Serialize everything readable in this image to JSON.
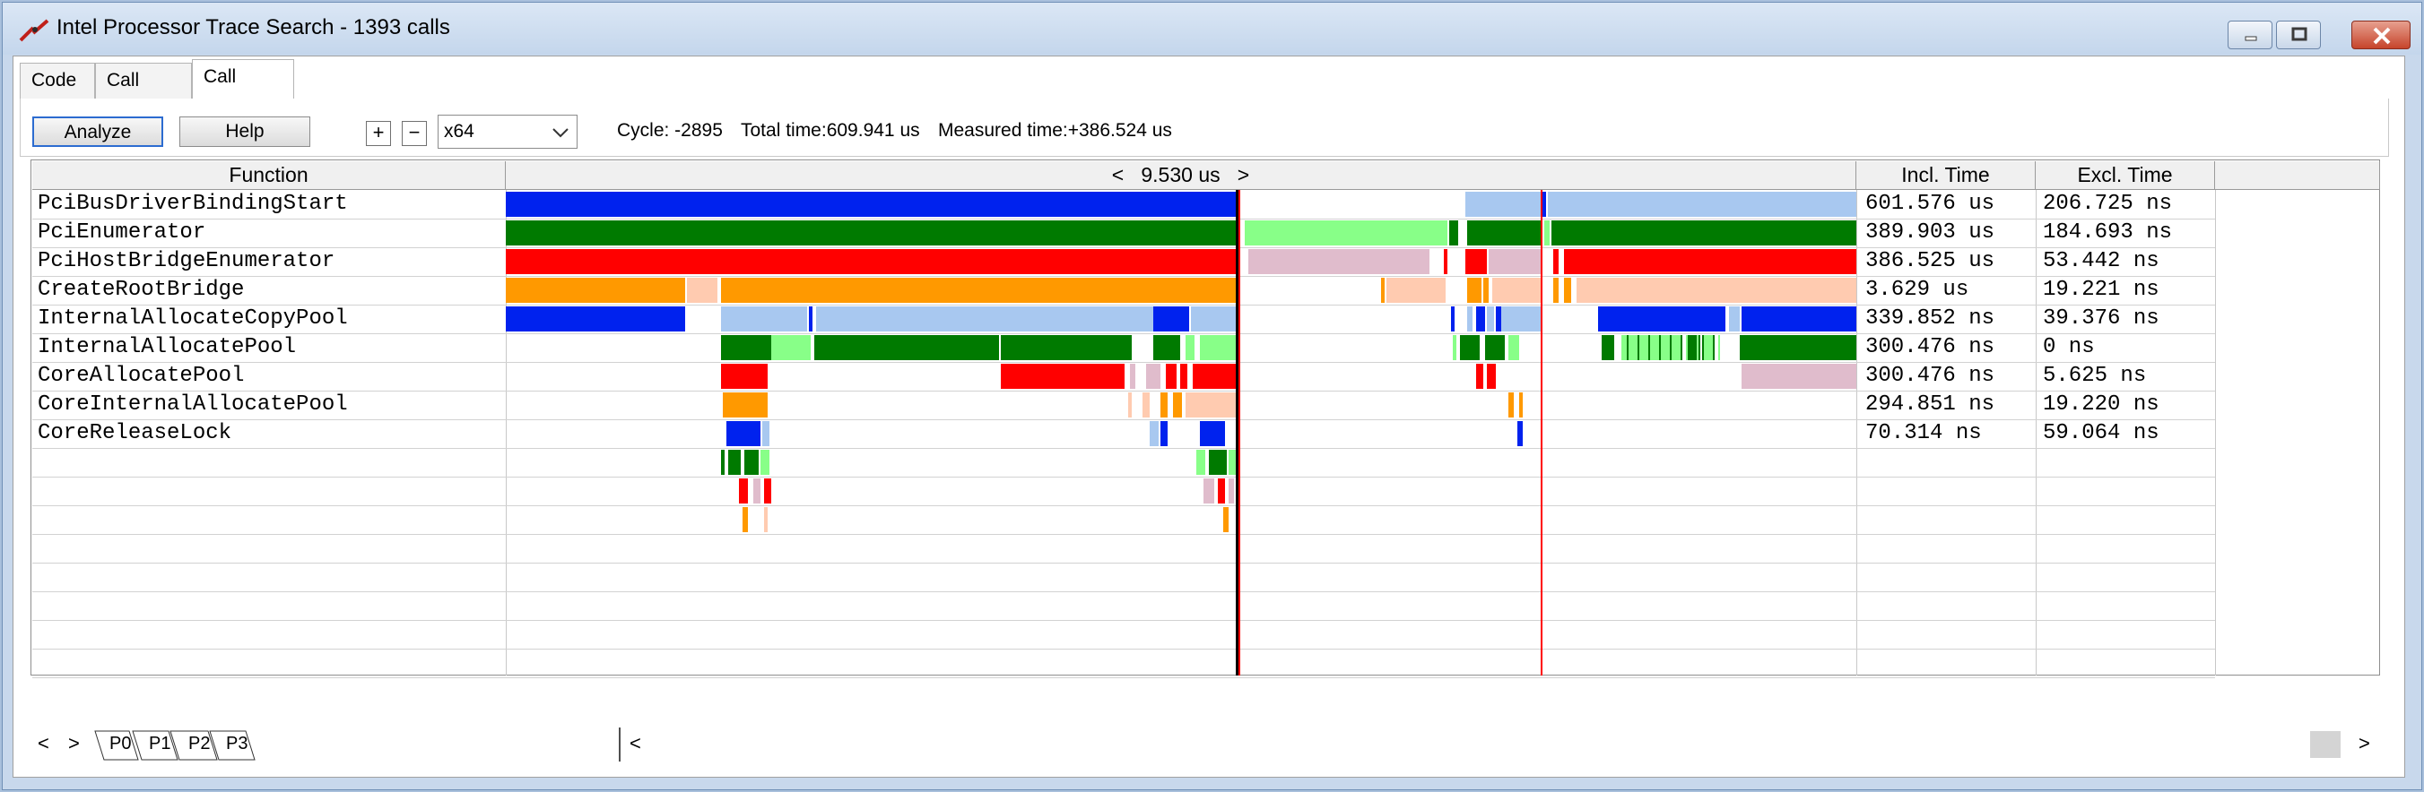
{
  "window": {
    "title": "Intel Processor Trace Search - 1393 calls"
  },
  "tabs": [
    {
      "label": "Code",
      "active": false
    },
    {
      "label": "Call Tree",
      "active": false
    },
    {
      "label": "Call Chart",
      "active": true
    }
  ],
  "toolbar": {
    "analyze_label": "Analyze",
    "help_label": "Help",
    "zoom_in": "+",
    "zoom_out": "−",
    "arch_value": "x64",
    "cycle": "Cycle: -2895",
    "total_time": "Total time:609.941 us",
    "measured_time": "Measured time:+386.524 us"
  },
  "columns": {
    "function": "Function",
    "timeline": "<   9.530 us   >",
    "incl": "Incl. Time",
    "excl": "Excl. Time"
  },
  "rows": [
    {
      "function": "PciBusDriverBindingStart",
      "incl": "601.576 us",
      "excl": "206.725 ns"
    },
    {
      "function": "PciEnumerator",
      "incl": "389.903 us",
      "excl": "184.693 ns"
    },
    {
      "function": "PciHostBridgeEnumerator",
      "incl": "386.525 us",
      "excl": "53.442 ns"
    },
    {
      "function": "CreateRootBridge",
      "incl": "3.629 us",
      "excl": "19.221 ns"
    },
    {
      "function": "InternalAllocateCopyPool",
      "incl": "339.852 ns",
      "excl": "39.376 ns"
    },
    {
      "function": "InternalAllocatePool",
      "incl": "300.476 ns",
      "excl": "0 ns"
    },
    {
      "function": "CoreAllocatePool",
      "incl": "300.476 ns",
      "excl": "5.625 ns"
    },
    {
      "function": "CoreInternalAllocatePool",
      "incl": "294.851 ns",
      "excl": "19.220 ns"
    },
    {
      "function": "CoreReleaseLock",
      "incl": "70.314 ns",
      "excl": "59.064 ns"
    }
  ],
  "processor_tabs": [
    "P0",
    "P1",
    "P2",
    "P3"
  ],
  "nav": {
    "prev": "<",
    "next": ">",
    "scroll_left": "<",
    "scroll_right": ">"
  },
  "colors": {
    "depth": [
      "#0022ee",
      "#007a00",
      "#ff0000",
      "#ff9900"
    ],
    "depth_light": [
      "#a8c8f0",
      "#88ff88",
      "#e0bccc",
      "#ffcbb0"
    ],
    "cursor": "#ff0000"
  },
  "icons": {
    "app": "trace-app-icon",
    "minimize": "minimize-icon",
    "maximize": "maximize-icon",
    "close": "close-icon",
    "dropdown": "chevron-down-icon"
  }
}
